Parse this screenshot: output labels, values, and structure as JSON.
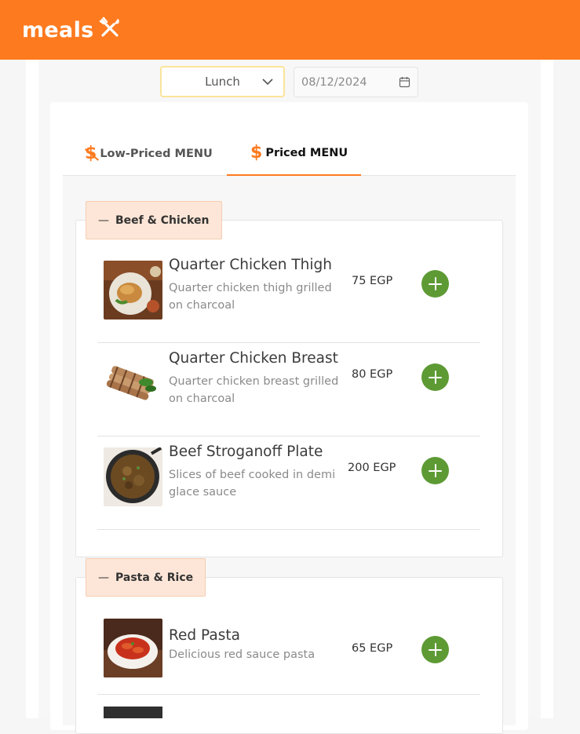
{
  "app": {
    "logo_text": "meals",
    "logo_icon": "fork-knife-icon",
    "accent_color": "#fe7a1f"
  },
  "filters": {
    "meal_type": "Lunch",
    "date": "08/12/2024"
  },
  "tabs": [
    {
      "label": "Low-Priced MENU",
      "icon": "dollar-off-icon",
      "active": false
    },
    {
      "label": "Priced MENU",
      "icon": "dollar-icon",
      "active": true
    }
  ],
  "categories": [
    {
      "name": "Beef & Chicken",
      "items": [
        {
          "name": "Quarter Chicken Thigh",
          "description": "Quarter chicken thigh grilled on charcoal",
          "price": "75 EGP"
        },
        {
          "name": "Quarter Chicken Breast",
          "description": "Quarter chicken breast grilled on charcoal",
          "price": "80 EGP"
        },
        {
          "name": "Beef Stroganoff Plate",
          "description": "Slices of beef cooked in demi glace sauce",
          "price": "200 EGP"
        }
      ]
    },
    {
      "name": "Pasta & Rice",
      "items": [
        {
          "name": "Red Pasta",
          "description": "Delicious red sauce pasta",
          "price": "65 EGP"
        }
      ]
    }
  ],
  "colors": {
    "add_button": "#5d9a34",
    "category_header_bg": "#fde6d7"
  }
}
